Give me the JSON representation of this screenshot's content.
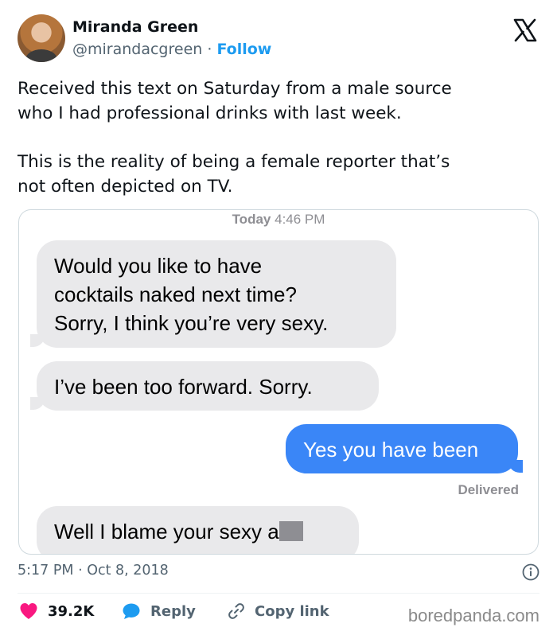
{
  "author": {
    "name": "Miranda Green",
    "handle": "@mirandacgreen",
    "separator": " · ",
    "follow_label": "Follow"
  },
  "tweet": {
    "paragraph1_lines": [
      "Received this text on Saturday from a male source",
      "who I had professional drinks with last week."
    ],
    "paragraph2_lines": [
      "This is the reality of being a female reporter that’s",
      "not often depicted on TV."
    ],
    "timestamp": "5:17 PM · Oct 8, 2018"
  },
  "messages": {
    "header_day": "Today",
    "header_time": "4:46 PM",
    "bubbles": [
      {
        "from": "them",
        "lines": [
          "Would you like to have",
          "cocktails naked next time?",
          "Sorry, I think you’re very sexy."
        ]
      },
      {
        "from": "them",
        "lines": [
          "I’ve been too forward. Sorry."
        ]
      },
      {
        "from": "me",
        "lines": [
          "Yes you have been"
        ]
      },
      {
        "from": "them",
        "lines": [
          "Well I blame your sexy a"
        ]
      }
    ],
    "delivered": "Delivered"
  },
  "actions": {
    "like_count": "39.2K",
    "reply_label": "Reply",
    "copy_link_label": "Copy link"
  },
  "watermark": "boredpanda.com",
  "colors": {
    "like": "#f91880",
    "reply": "#1d9bf0",
    "follow": "#1d9bf0",
    "imessage_blue": "#3a86f7",
    "imessage_gray": "#e9e9eb"
  },
  "icons": [
    "x-logo-icon",
    "info-icon",
    "heart-icon",
    "reply-bubble-icon",
    "link-icon"
  ]
}
